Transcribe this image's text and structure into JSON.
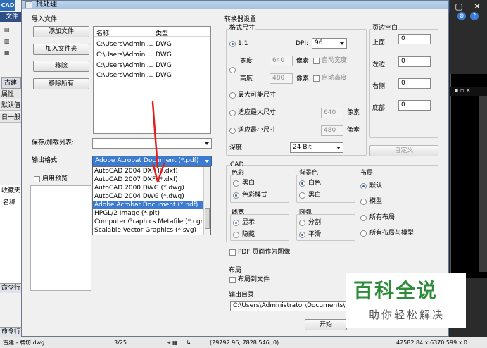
{
  "app": {
    "logo": "CAD",
    "menu_file": "文件",
    "side_tab": "古建",
    "side_prop": "属性",
    "side_default": "默认值",
    "side_group": "日一般",
    "collect": "收藏夹",
    "name": "名称",
    "cmd1": "命令行",
    "cmd2": "命令行",
    "status_file": "古建 - 牌坊.dwg",
    "status_page": "3/25",
    "status_coord": "(29792.96; 7828.546; 0)",
    "status_coord2": "42582.84 x 6370.599 x 0"
  },
  "dialog": {
    "title": "批处理",
    "import_label": "导入文件:",
    "btn_add_file": "添加文件",
    "btn_add_folder": "加入文件夹",
    "btn_remove": "移除",
    "btn_remove_all": "移除所有",
    "list_col_name": "名称",
    "list_col_type": "类型",
    "files": [
      {
        "name": "C:\\Users\\Admini...",
        "type": "DWG"
      },
      {
        "name": "C:\\Users\\Admini...",
        "type": "DWG"
      },
      {
        "name": "C:\\Users\\Admini...",
        "type": "DWG"
      },
      {
        "name": "C:\\Users\\Admini...",
        "type": "DWG"
      }
    ],
    "save_load_label": "保存/加载列表:",
    "output_format_label": "输出格式:",
    "output_format_value": "Adobe Acrobat Document (*.pdf)",
    "enable_preview": "启用预览",
    "format_options": [
      "AutoCAD 2004 DXF (*.dxf)",
      "AutoCAD 2007 DXF (*.dxf)",
      "AutoCAD 2000 DWG (*.dwg)",
      "AutoCAD 2004 DWG (*.dwg)",
      "Adobe Acrobat Document (*.pdf)",
      "HPGL/2 Image (*.plt)",
      "Computer Graphics Metafile (*.cgm)",
      "Scalable Vector Graphics (*.svg)"
    ],
    "converter_settings": "转换器设置",
    "format_size": "格式尺寸",
    "ratio": "1:1",
    "dpi_label": "DPI:",
    "dpi_value": "96",
    "width_label": "宽度",
    "width_value": "640",
    "height_label": "高度",
    "height_value": "480",
    "px_unit": "像素",
    "auto_width": "自动宽度",
    "auto_height": "自动高度",
    "max_size": "最大可能尺寸",
    "fit_max": "适应最大尺寸",
    "fit_max_value": "640",
    "fit_min": "适应最小尺寸",
    "fit_min_value": "480",
    "depth_label": "深度:",
    "depth_value": "24 Bit",
    "margins_title": "页边空白",
    "margin_top": "上面",
    "margin_left": "左边",
    "margin_right": "右侧",
    "margin_bottom": "底部",
    "margin_top_value": "0",
    "margin_left_value": "0",
    "margin_right_value": "0",
    "margin_bottom_value": "0",
    "custom": "自定义",
    "cad_title": "CAD",
    "color_title": "色彩",
    "color_bw": "黑白",
    "color_mode": "色彩模式",
    "bg_title": "背景色",
    "bg_white": "白色",
    "bg_black": "黑白",
    "layout_title": "布局",
    "layout_default": "默认",
    "layout_model": "模型",
    "layout_all": "所有布局",
    "layout_all_model": "所有布局与模型",
    "lw_title": "线宽",
    "lw_show": "显示",
    "lw_hide": "隐藏",
    "arc_title": "圆弧",
    "arc_split": "分割",
    "arc_smooth": "平滑",
    "pdf_as_image": "PDF 页面作为图像",
    "layout2_title": "布局",
    "layout_to_file": "布局到文件",
    "output_dir_label": "输出目录:",
    "output_dir_value": "C:\\Users\\Administrator\\Documents\\CAD",
    "start_button": "开始"
  },
  "watermark": {
    "logo": "百科全说",
    "tagline": "助你轻松解决"
  },
  "colors": {
    "accent": "#3d7bd1",
    "arrow": "#e02020",
    "watermark_green": "#2e8b3a"
  }
}
